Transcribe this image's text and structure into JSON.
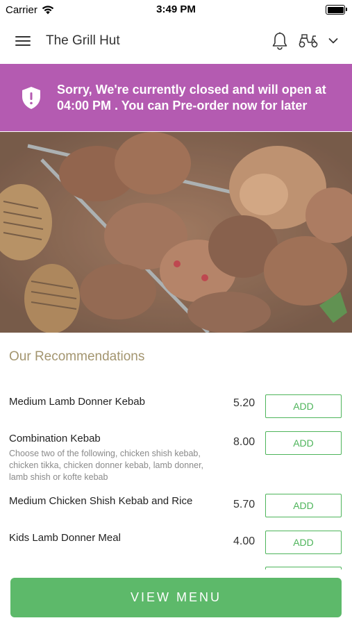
{
  "status_bar": {
    "carrier": "Carrier",
    "time": "3:49 PM"
  },
  "header": {
    "title": "The Grill Hut"
  },
  "banner": {
    "message": "Sorry, We're currently closed and will open at 04:00 PM . You can Pre-order now for later",
    "color": "#b45bb1"
  },
  "recommendations": {
    "title": "Our Recommendations",
    "items": [
      {
        "name": "Medium Lamb Donner Kebab",
        "description": "",
        "price": "5.20",
        "button": "ADD"
      },
      {
        "name": "Combination Kebab",
        "description": "Choose two of the following, chicken shish kebab, chicken tikka, chicken donner kebab, lamb donner, lamb shish or kofte kebab",
        "price": "8.00",
        "button": "ADD"
      },
      {
        "name": "Medium Chicken Shish Kebab and Rice",
        "description": "",
        "price": "5.70",
        "button": "ADD"
      },
      {
        "name": "Kids Lamb Donner Meal",
        "description": "",
        "price": "4.00",
        "button": "ADD"
      }
    ]
  },
  "view_menu_label": "VIEW MENU",
  "colors": {
    "accent": "#5db96a",
    "banner": "#b45bb1",
    "section_title": "#a3956f"
  }
}
